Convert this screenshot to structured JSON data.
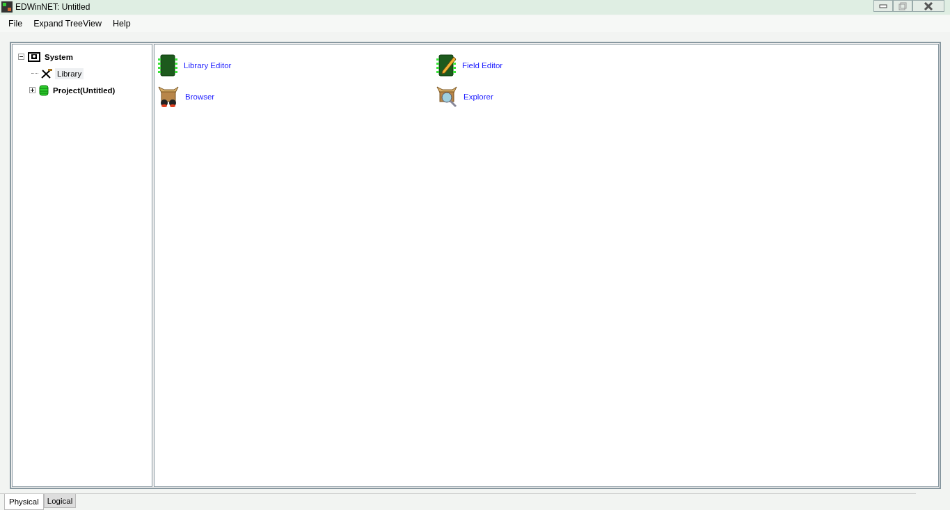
{
  "window": {
    "title": "EDWinNET: Untitled"
  },
  "menu": [
    "File",
    "Expand TreeView",
    "Help"
  ],
  "tree": [
    {
      "label": "System",
      "kind": "system",
      "bold": true,
      "expanded": true,
      "selected": false,
      "children": [
        {
          "label": "Library",
          "kind": "tools",
          "bold": false,
          "selected": true
        },
        {
          "label": "Project(Untitled)",
          "kind": "database",
          "bold": true,
          "expanded": false,
          "selected": false
        }
      ]
    }
  ],
  "launchers": [
    {
      "label": "Library Editor",
      "kind": "chip"
    },
    {
      "label": "Field Editor",
      "kind": "chip-pencil"
    },
    {
      "label": "Browser",
      "kind": "box-binoculars"
    },
    {
      "label": "Explorer",
      "kind": "box-magnifier"
    }
  ],
  "tabs": [
    {
      "label": "Physical",
      "selected": true
    },
    {
      "label": "Logical",
      "selected": false
    }
  ]
}
